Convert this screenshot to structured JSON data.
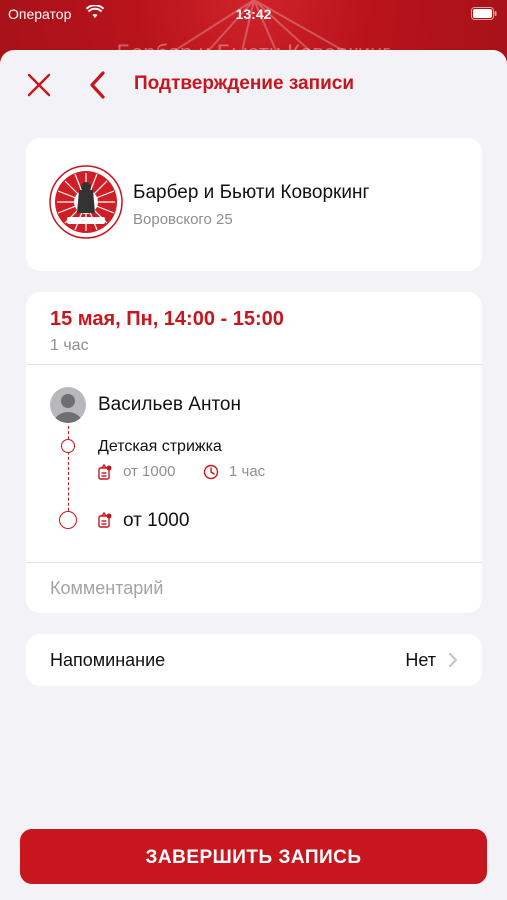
{
  "status_bar": {
    "carrier": "Оператор",
    "time": "13:42"
  },
  "background": {
    "title": "Барбер и Бьюти Коворкинг"
  },
  "nav": {
    "title": "Подтверждение записи"
  },
  "salon": {
    "name": "Барбер и Бьюти Коворкинг",
    "address": "Воровского 25"
  },
  "booking": {
    "when": "15 мая, Пн, 14:00 - 15:00",
    "duration": "1 час",
    "master": "Васильев Антон",
    "service": {
      "name": "Детская стрижка",
      "price": "от 1000",
      "duration": "1 час"
    },
    "total": "от 1000",
    "comment_placeholder": "Комментарий"
  },
  "reminder": {
    "label": "Напоминание",
    "value": "Нет"
  },
  "submit_label": "ЗАВЕРШИТЬ ЗАПИСЬ",
  "colors": {
    "accent": "#c8161e",
    "background": "#f2f2f7",
    "card": "#ffffff",
    "muted": "#8e8e93"
  },
  "icons": [
    "close-icon",
    "back-chevron-icon",
    "wifi-icon",
    "battery-icon",
    "salon-logo",
    "avatar-icon",
    "price-tag-icon",
    "clock-icon",
    "chevron-right-icon"
  ]
}
